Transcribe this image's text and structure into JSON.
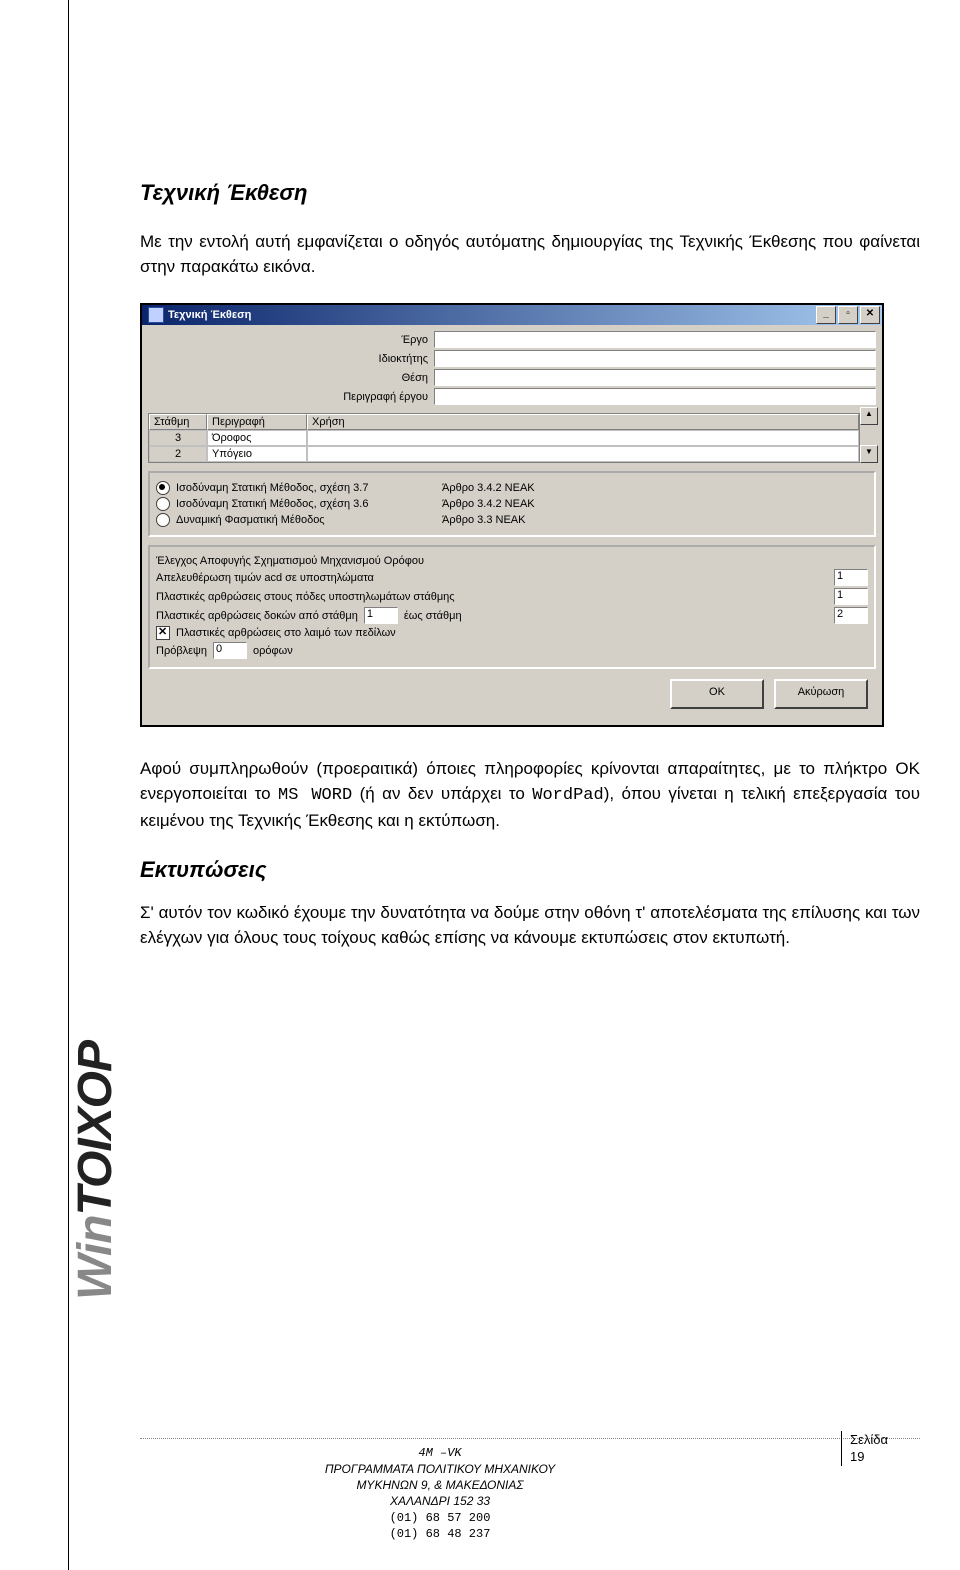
{
  "doc": {
    "section1_title": "Τεχνική Έκθεση",
    "para1": "Με την εντολή αυτή εμφανίζεται ο οδηγός αυτόματης δημιουργίας της Τεχνικής Έκθεσης που φαίνεται στην παρακάτω εικόνα.",
    "para2_a": "Αφού συμπληρωθούν (προεραιτικά) όποιες πληροφορίες κρίνονται απαραίτητες, με το πλήκτρο ΟΚ ενεργοποιείται το ",
    "para2_mono1": "MS WORD",
    "para2_b": " (ή αν δεν υπάρχει το ",
    "para2_mono2": "WordPad",
    "para2_c": "), όπου γίνεται η τελική επεξεργασία του κειμένου της Τεχνικής Έκθεσης και η εκτύπωση.",
    "section2_title": "Εκτυπώσεις",
    "para3": "Σ' αυτόν τον κωδικό έχουμε την δυνατότητα να δούμε στην οθόνη τ' αποτελέσματα της επίλυσης και των ελέγχων για όλους τους τοίχους καθώς επίσης να κάνουμε εκτυπώσεις στον εκτυπωτή."
  },
  "logo": {
    "light": "Win",
    "dark": "TOIXOP"
  },
  "footer": {
    "l1": "4M –VK",
    "l2": "ΠΡΟΓΡΑΜΜΑΤΑ ΠΟΛΙΤΙΚΟΥ ΜΗΧΑΝΙΚΟΥ",
    "l3": "ΜΥΚΗΝΩΝ 9, & ΜΑΚΕΔΟΝΙΑΣ",
    "l4": "ΧΑΛΑΝΔΡΙ 152 33",
    "l5": "(01) 68 57 200",
    "l6": "(01) 68 48 237",
    "page_label": "Σελίδα",
    "page_num": "19"
  },
  "win": {
    "title": "Τεχνική Έκθεση",
    "min": "_",
    "max": "▫",
    "close": "✕",
    "labels": {
      "ergo": "Έργο",
      "owner": "Ιδιοκτήτης",
      "thesi": "Θέση",
      "desc": "Περιγραφή έργου"
    },
    "grid": {
      "h1": "Στάθμη",
      "h2": "Περιγραφή",
      "h3": "Χρήση",
      "r1c1": "3",
      "r1c2": "Όροφος",
      "r1c3": "",
      "r2c1": "2",
      "r2c2": "Υπόγειο",
      "r2c3": "",
      "scroll_up": "▲",
      "scroll_dn": "▼"
    },
    "radios": {
      "r1": "Ισοδύναμη Στατική Μέθοδος, σχέση 3.7",
      "r1ref": "Άρθρο 3.4.2 ΝΕΑΚ",
      "r2": "Ισοδύναμη Στατική Μέθοδος, σχέση 3.6",
      "r2ref": "Άρθρο 3.4.2 ΝΕΑΚ",
      "r3": "Δυναμική Φασματική Μέθοδος",
      "r3ref": "Άρθρο 3.3 ΝΕΑΚ"
    },
    "sect": {
      "title": "Έλεγχος Αποφυγής Σχηματισμού Μηχανισμού Ορόφου",
      "l1": "Απελευθέρωση τιμών acd σε υποστηλώματα",
      "l1v": "1",
      "l2": "Πλαστικές αρθρώσεις στους πόδες υποστηλωμάτων στάθμης",
      "l2v": "1",
      "l3a": "Πλαστικές αρθρώσεις δοκών από στάθμη",
      "l3v1": "1",
      "l3b": "έως στάθμη",
      "l3v2": "2",
      "chk": "Πλαστικές αρθρώσεις στο λαιμό των πεδίλων",
      "l4a": "Πρόβλεψη",
      "l4v": "0",
      "l4b": "ορόφων"
    },
    "btn_ok": "ΟΚ",
    "btn_cancel": "Ακύρωση"
  }
}
